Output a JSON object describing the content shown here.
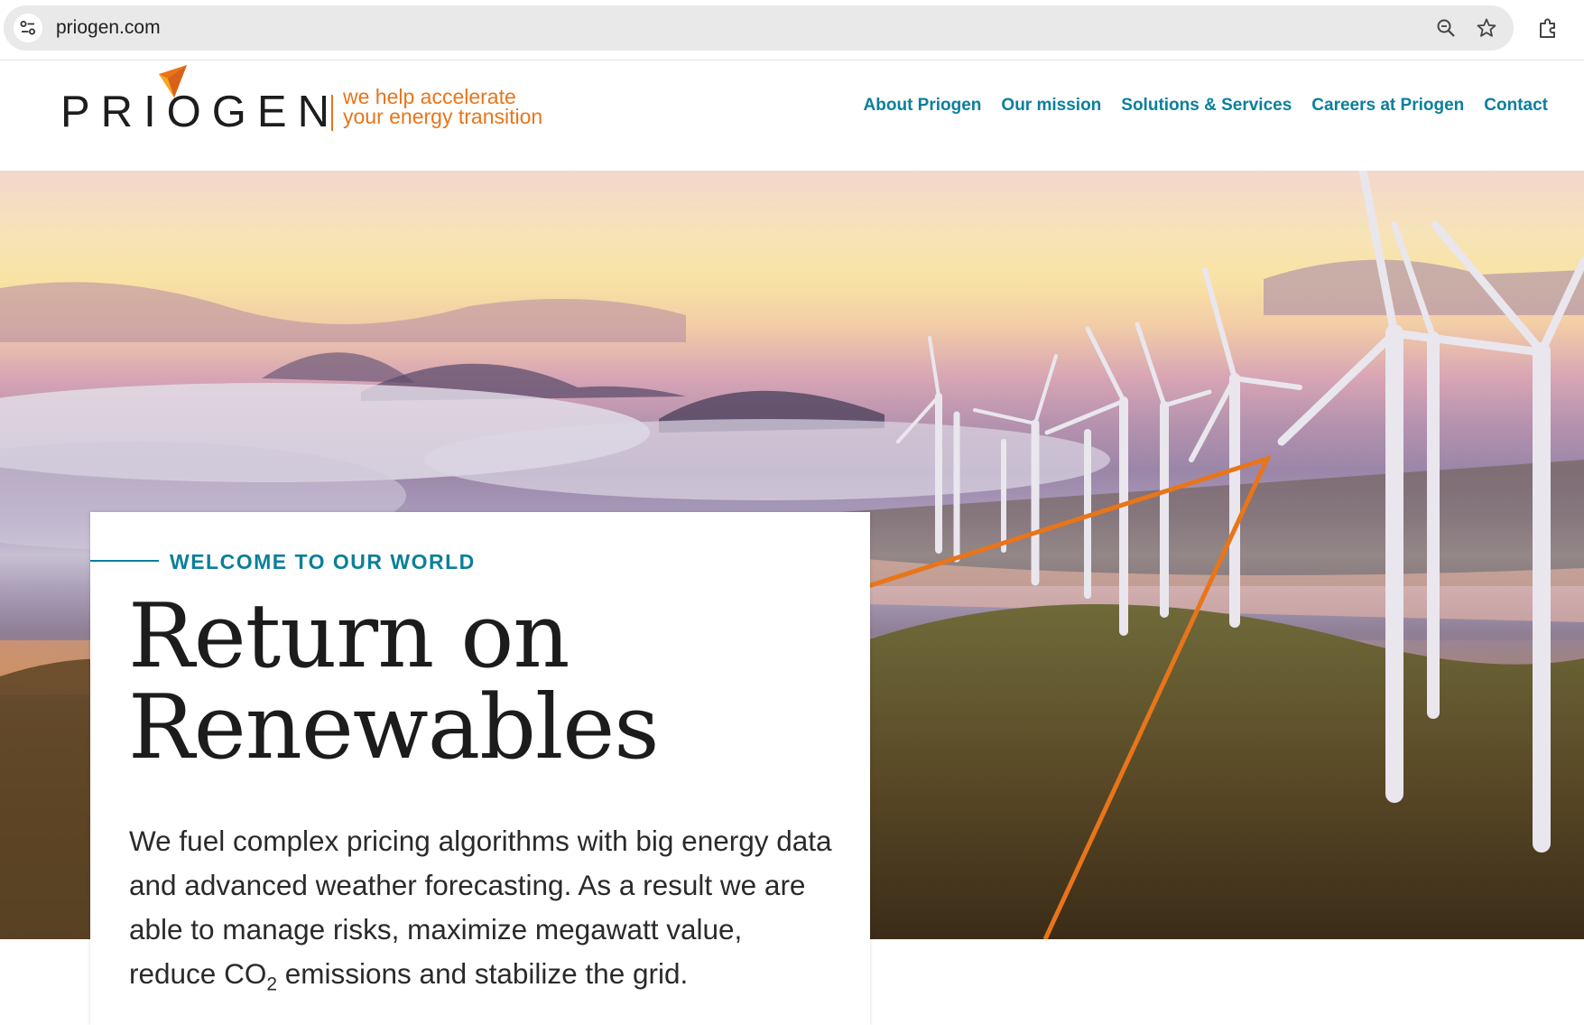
{
  "browser": {
    "url": "priogen.com",
    "icons": [
      "site-info-icon",
      "zoom-icon",
      "bookmark-star-icon",
      "extensions-icon"
    ]
  },
  "header": {
    "logo_text": "PRIOGEN",
    "tagline_line1": "we help accelerate",
    "tagline_line2": "your energy transition",
    "nav": [
      {
        "label": "About Priogen"
      },
      {
        "label": "Our mission"
      },
      {
        "label": "Solutions & Services"
      },
      {
        "label": "Careers at Priogen"
      },
      {
        "label": "Contact"
      }
    ]
  },
  "hero": {
    "eyebrow": "WELCOME TO OUR WORLD",
    "headline_line1": "Return on",
    "headline_line2": "Renewables",
    "body_before": "We fuel complex pricing algorithms with big energy data and advanced weather forecasting. As a result we are able to manage risks, maximize megawatt value, reduce CO",
    "body_sub": "2",
    "body_after": " emissions and stabilize the grid."
  },
  "colors": {
    "brand_orange": "#e8751a",
    "nav_teal": "#0b7f9c",
    "headline": "#1c1c1c"
  }
}
